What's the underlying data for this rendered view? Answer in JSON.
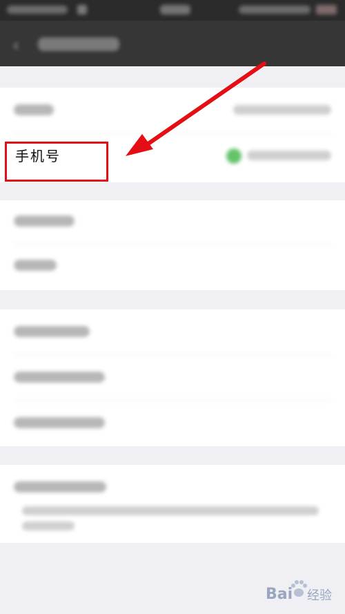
{
  "screen": {
    "phone_row_label": "手机号"
  },
  "colors": {
    "appbar": "#363636",
    "highlight": "#e30f14",
    "accent_green": "#63c36a",
    "page_bg": "#efeff4"
  },
  "icons": {
    "back": "chevron-left-icon",
    "arrow": "red-arrow-annotation"
  },
  "watermark": {
    "brand": "Bai",
    "suffix": "经验"
  }
}
